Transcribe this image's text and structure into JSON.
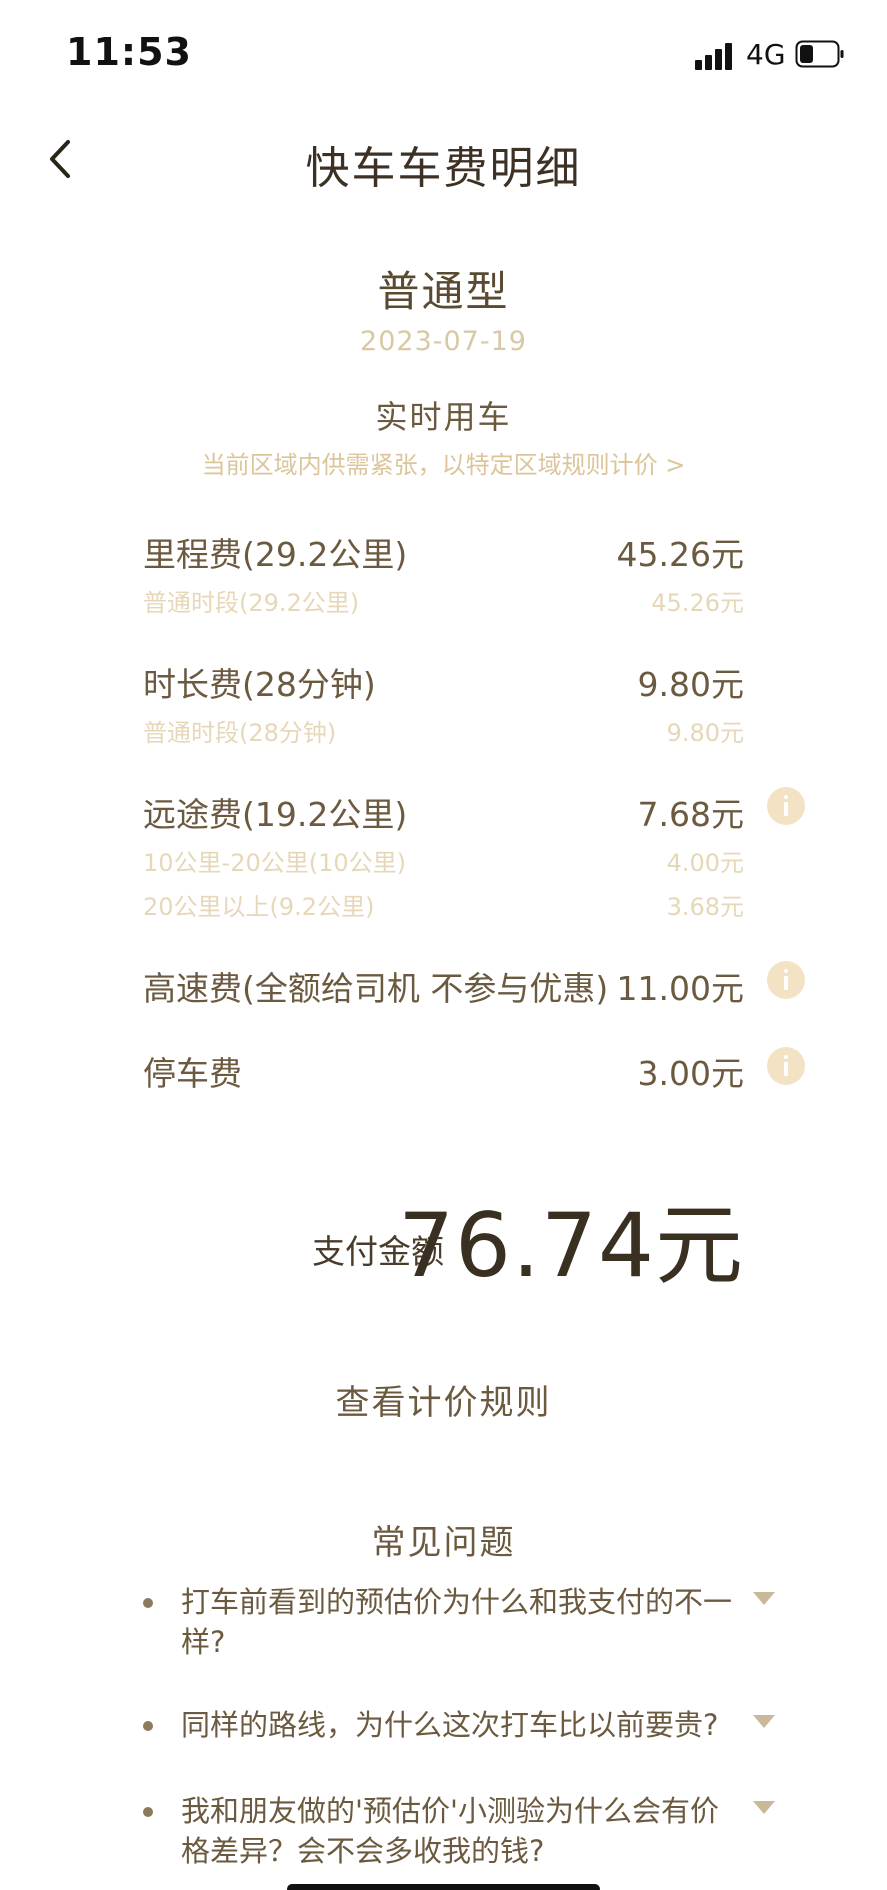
{
  "status_bar": {
    "time": "11:53",
    "network": "4G"
  },
  "header": {
    "title": "快车车费明细"
  },
  "summary": {
    "car_type": "普通型",
    "date": "2023-07-19",
    "mode": "实时用车",
    "notice": "当前区域内供需紧张，以特定区域规则计价 >"
  },
  "fees": [
    {
      "label": "里程费(29.2公里)",
      "amount": "45.26元",
      "details": [
        {
          "label": "普通时段(29.2公里)",
          "amount": "45.26元"
        }
      ]
    },
    {
      "label": "时长费(28分钟)",
      "amount": "9.80元",
      "details": [
        {
          "label": "普通时段(28分钟)",
          "amount": "9.80元"
        }
      ]
    },
    {
      "label": "远途费(19.2公里)",
      "amount": "7.68元",
      "details": [
        {
          "label": "10公里-20公里(10公里)",
          "amount": "4.00元"
        },
        {
          "label": "20公里以上(9.2公里)",
          "amount": "3.68元"
        }
      ]
    },
    {
      "label": "高速费(全额给司机 不参与优惠)",
      "amount": "11.00元",
      "details": []
    },
    {
      "label": "停车费",
      "amount": "3.00元",
      "details": []
    }
  ],
  "payment": {
    "label": "支付金额",
    "amount": "76.74元"
  },
  "rules_link": "查看计价规则",
  "faq": {
    "title": "常见问题",
    "items": [
      "打车前看到的预估价为什么和我支付的不一样?",
      "同样的路线，为什么这次打车比以前要贵?",
      "我和朋友做的'预估价'小测验为什么会有价格差异？会不会多收我的钱?"
    ]
  },
  "colors": {
    "accent": "#f3e2c3",
    "text": "#6b5a3f",
    "muted": "#e6d7b8"
  },
  "icons": {
    "back": "chevron-left-icon",
    "info": "info-icon",
    "expand": "caret-down-icon"
  }
}
